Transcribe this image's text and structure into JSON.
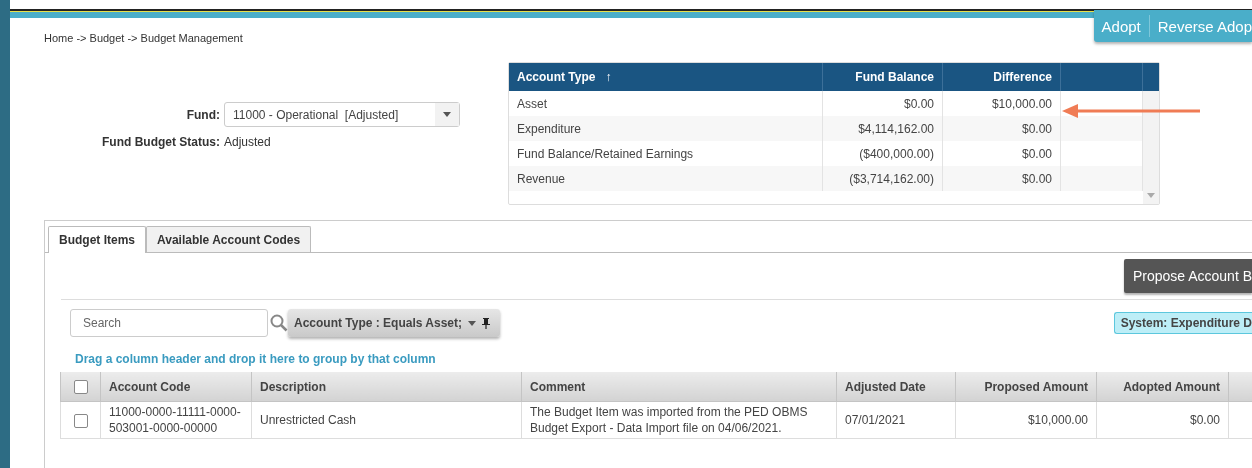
{
  "top_actions": [
    {
      "label": "Adopt"
    },
    {
      "label": "Reverse Adop"
    }
  ],
  "breadcrumb": "Home -> Budget -> Budget Management",
  "fund": {
    "label": "Fund:",
    "value": "11000 - Operational  [Adjusted]"
  },
  "status": {
    "label": "Fund Budget Status:",
    "value": "Adjusted"
  },
  "summary_table": {
    "sort_indicator": "↑",
    "columns": [
      {
        "label": "Account Type",
        "kind": "text",
        "sorted": true
      },
      {
        "label": "Fund Balance",
        "kind": "amount",
        "sorted": false
      },
      {
        "label": "Difference",
        "kind": "amount",
        "sorted": false
      }
    ],
    "rows": [
      [
        "Asset",
        "$0.00",
        "$10,000.00"
      ],
      [
        "Expenditure",
        "$4,114,162.00",
        "$0.00"
      ],
      [
        "Fund Balance/Retained Earnings",
        "($400,000.00)",
        "$0.00"
      ],
      [
        "Revenue",
        "($3,714,162.00)",
        "$0.00"
      ]
    ]
  },
  "tabs": [
    {
      "label": "Budget Items",
      "selected": true
    },
    {
      "label": "Available Account Codes",
      "selected": false
    }
  ],
  "propose_button": "Propose Account B",
  "search": {
    "placeholder": "Search"
  },
  "filter_chip": "Account Type : Equals Asset;",
  "system_tag": "System: Expenditure D",
  "group_hint": "Drag a column header and drop it here to group by that column",
  "grid": {
    "select_all": {
      "checked": false
    },
    "columns": [
      {
        "label": "Account Code",
        "kind": "text"
      },
      {
        "label": "Description",
        "kind": "text"
      },
      {
        "label": "Comment",
        "kind": "text"
      },
      {
        "label": "Adjusted Date",
        "kind": "text"
      },
      {
        "label": "Proposed Amount",
        "kind": "amount"
      },
      {
        "label": "Adopted Amount",
        "kind": "amount"
      }
    ],
    "rows": [
      {
        "checked": false,
        "cells": [
          "11000-0000-11111-0000-503001-0000-00000",
          "Unrestricted Cash",
          "The Budget Item was imported from the PED OBMS Budget Export - Data Import file on 04/06/2021.",
          "07/01/2021",
          "$10,000.00",
          "$0.00"
        ]
      }
    ]
  }
}
